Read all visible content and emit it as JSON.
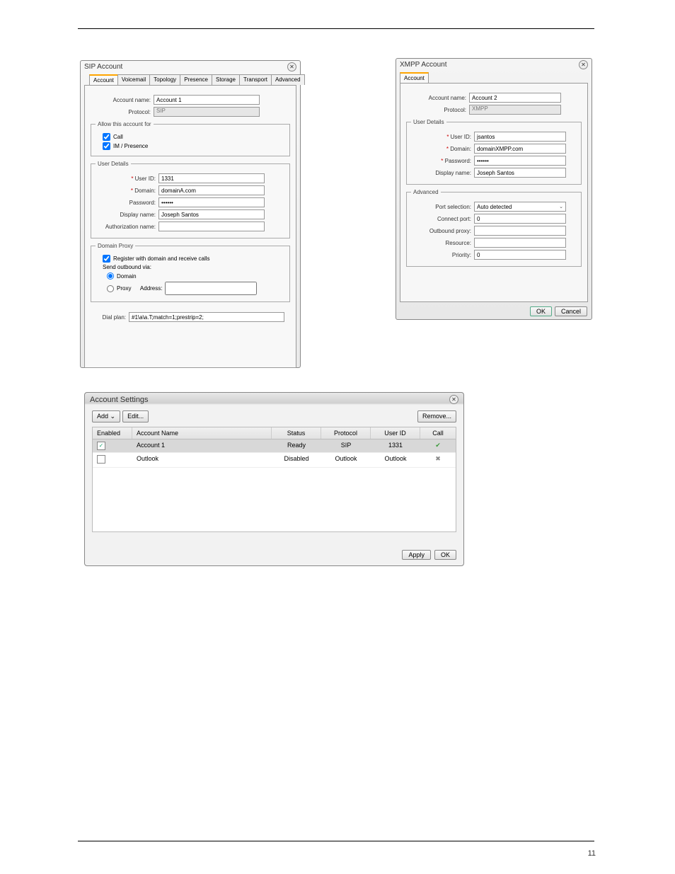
{
  "page_number": "11",
  "sip": {
    "title": "SIP Account",
    "tabs": [
      "Account",
      "Voicemail",
      "Topology",
      "Presence",
      "Storage",
      "Transport",
      "Advanced"
    ],
    "account_name_label": "Account name:",
    "account_name": "Account 1",
    "protocol_label": "Protocol:",
    "protocol": "SIP",
    "allow_legend": "Allow this account for",
    "allow_call": "Call",
    "allow_im": "IM / Presence",
    "user_legend": "User Details",
    "user_id_label": "User ID:",
    "user_id": "1331",
    "domain_label": "Domain:",
    "domain": "domainA.com",
    "password_label": "Password:",
    "password": "••••••",
    "display_name_label": "Display name:",
    "display_name": "Joseph Santos",
    "auth_name_label": "Authorization name:",
    "proxy_legend": "Domain Proxy",
    "register_label": "Register with domain and receive calls",
    "send_label": "Send outbound via:",
    "opt_domain": "Domain",
    "opt_proxy": "Proxy",
    "address_label": "Address:",
    "dial_plan_label": "Dial plan:",
    "dial_plan": "#1\\a\\a.T;match=1;prestrip=2;"
  },
  "xmpp": {
    "title": "XMPP Account",
    "tab": "Account",
    "account_name_label": "Account name:",
    "account_name": "Account 2",
    "protocol_label": "Protocol:",
    "protocol": "XMPP",
    "user_legend": "User Details",
    "user_id_label": "User ID:",
    "user_id": "jsantos",
    "domain_label": "Domain:",
    "domain": "domainXMPP.com",
    "password_label": "Password:",
    "password": "••••••",
    "display_name_label": "Display name:",
    "display_name": "Joseph Santos",
    "adv_legend": "Advanced",
    "port_sel_label": "Port selection:",
    "port_sel": "Auto detected",
    "connect_port_label": "Connect port:",
    "connect_port": "0",
    "outbound_label": "Outbound proxy:",
    "resource_label": "Resource:",
    "priority_label": "Priority:",
    "priority": "0",
    "ok": "OK",
    "cancel": "Cancel"
  },
  "settings": {
    "title": "Account Settings",
    "add": "Add ",
    "edit": "Edit...",
    "remove": "Remove...",
    "cols": {
      "enabled": "Enabled",
      "name": "Account Name",
      "status": "Status",
      "protocol": "Protocol",
      "userid": "User ID",
      "call": "Call"
    },
    "rows": [
      {
        "enabled": "✓",
        "name": "Account 1",
        "status": "Ready",
        "protocol": "SIP",
        "userid": "1331",
        "call": "check"
      },
      {
        "enabled": "",
        "name": "Outlook",
        "status": "Disabled",
        "protocol": "Outlook",
        "userid": "Outlook",
        "call": "x"
      }
    ],
    "apply": "Apply",
    "ok": "OK"
  }
}
